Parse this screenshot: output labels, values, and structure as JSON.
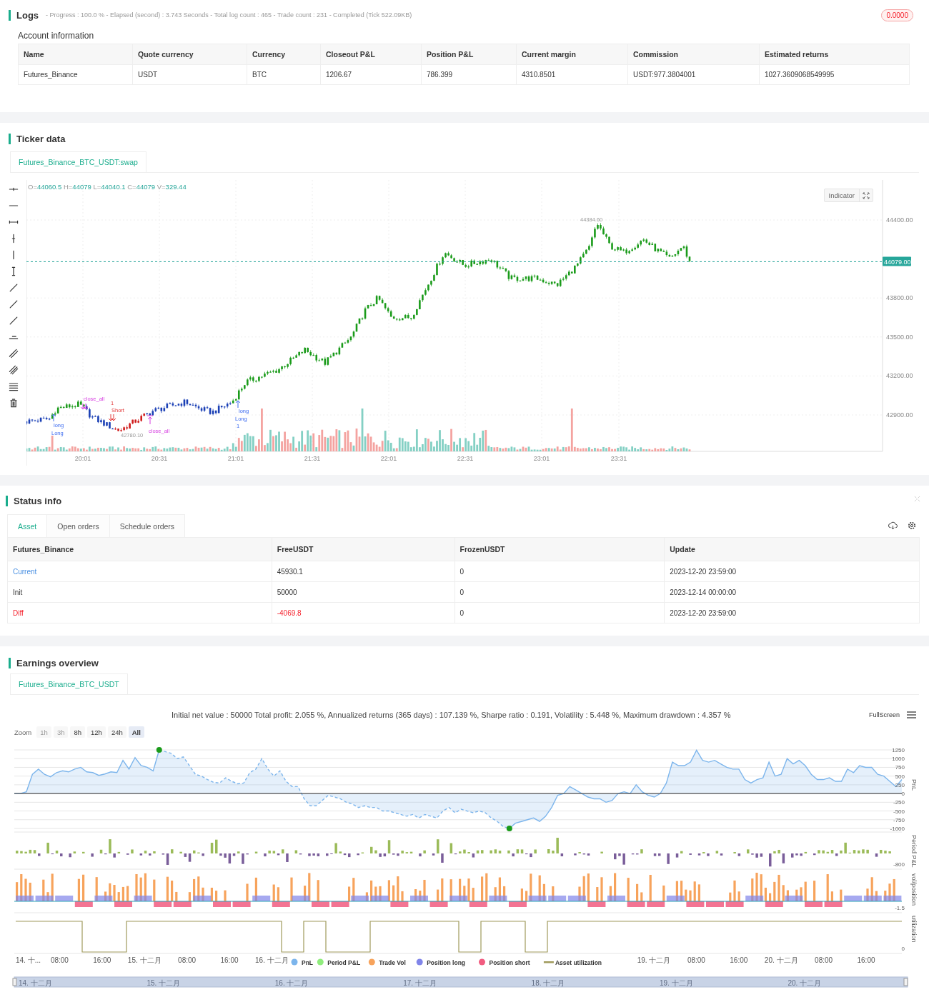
{
  "logs": {
    "title": "Logs",
    "summary": "- Progress : 100.0 % - Elapsed (second) : 3.743  Seconds - Total log count : 465 - Trade count : 231 - Completed (Tick 522.09KB)",
    "badge": "0.0000",
    "account_title": "Account information",
    "columns": [
      "Name",
      "Quote currency",
      "Currency",
      "Closeout P&L",
      "Position P&L",
      "Current margin",
      "Commission",
      "Estimated returns"
    ],
    "rows": [
      [
        "Futures_Binance",
        "USDT",
        "BTC",
        "1206.67",
        "786.399",
        "4310.8501",
        "USDT:977.3804001",
        "1027.3609068549995"
      ]
    ]
  },
  "ticker": {
    "title": "Ticker data",
    "tabs": [
      {
        "label": "Futures_Binance_BTC_USDT:swap",
        "selected": true
      }
    ],
    "ohlc": [
      {
        "label": "O=",
        "value": "44060.5"
      },
      {
        "label": " H=",
        "value": "44079"
      },
      {
        "label": " L=",
        "value": "44040.1"
      },
      {
        "label": " C=",
        "value": "44079"
      },
      {
        "label": " V=",
        "value": "329.44"
      }
    ],
    "indicator_button": "Indicator",
    "yticks": [
      "44400.00",
      "43800.00",
      "43500.00",
      "43200.00",
      "42900.00"
    ],
    "price_tag": "44079.00",
    "high_label": "44384.60",
    "low_label": "42780.10",
    "xticks": [
      "20:01",
      "20:31",
      "21:01",
      "21:31",
      "22:01",
      "22:31",
      "23:01",
      "23:31"
    ],
    "trade_labels": [
      {
        "kind": "long",
        "text": "long"
      },
      {
        "kind": "long",
        "text": "Long"
      },
      {
        "kind": "close",
        "text": "close_all"
      },
      {
        "kind": "short",
        "text": "1"
      },
      {
        "kind": "short",
        "text": "Short"
      },
      {
        "kind": "close",
        "text": "close_all"
      },
      {
        "kind": "long",
        "text": "long"
      },
      {
        "kind": "long",
        "text": "Long"
      },
      {
        "kind": "long",
        "text": "1"
      }
    ]
  },
  "status": {
    "title": "Status info",
    "tabs": [
      {
        "label": "Asset",
        "selected": true
      },
      {
        "label": "Open orders",
        "selected": false
      },
      {
        "label": "Schedule orders",
        "selected": false
      }
    ],
    "columns": [
      "Futures_Binance",
      "FreeUSDT",
      "FrozenUSDT",
      "Update"
    ],
    "rows": [
      {
        "cells": [
          {
            "text": "Current",
            "color": "#4a90e2"
          },
          {
            "text": "45930.1"
          },
          {
            "text": "0"
          },
          {
            "text": "2023-12-20 23:59:00"
          }
        ]
      },
      {
        "cells": [
          {
            "text": "Init"
          },
          {
            "text": "50000"
          },
          {
            "text": "0"
          },
          {
            "text": "2023-12-14 00:00:00"
          }
        ]
      },
      {
        "cells": [
          {
            "text": "Diff",
            "color": "#f5222d"
          },
          {
            "text": "-4069.8",
            "color": "#f5222d"
          },
          {
            "text": "0"
          },
          {
            "text": "2023-12-20 23:59:00"
          }
        ]
      }
    ]
  },
  "earnings": {
    "title": "Earnings overview",
    "tabs": [
      {
        "label": "Futures_Binance_BTC_USDT",
        "selected": true
      }
    ],
    "summary": "Initial net value : 50000 Total profit: 2.055 %, Annualized returns (365 days) : 107.139 %, Sharpe ratio : 0.191, Volatility : 5.448 %, Maximum drawdown : 4.357 %",
    "fullscreen": "FullScreen",
    "zoom_label": "Zoom",
    "zoom_buttons": [
      {
        "label": "1h",
        "selected": false,
        "disabled": true
      },
      {
        "label": "3h",
        "selected": false,
        "disabled": true
      },
      {
        "label": "8h",
        "selected": false,
        "disabled": false
      },
      {
        "label": "12h",
        "selected": false,
        "disabled": false
      },
      {
        "label": "24h",
        "selected": false,
        "disabled": false
      },
      {
        "label": "All",
        "selected": true,
        "disabled": false
      }
    ],
    "chart_data": {
      "type": "area",
      "ylabel": "PnL",
      "ylim": [
        -1000,
        1250
      ],
      "grid": true,
      "yticks": [
        1250,
        1000,
        750,
        500,
        250,
        0,
        -250,
        -500,
        -750,
        -1000
      ],
      "series": [
        {
          "color": "#7cb5ec",
          "values": [
            0,
            0,
            50,
            550,
            700,
            550,
            480,
            600,
            650,
            620,
            700,
            750,
            620,
            600,
            520,
            560,
            620,
            600,
            950,
            700,
            1030,
            800,
            750,
            650,
            1250,
            1200,
            1150,
            1000,
            1050,
            800,
            550,
            500,
            400,
            320,
            300,
            450,
            350,
            280,
            300,
            600,
            700,
            1000,
            700,
            500,
            650,
            350,
            200,
            200,
            -150,
            -350,
            -350,
            -200,
            -50,
            -100,
            -150,
            -250,
            -300,
            -400,
            -350,
            -400,
            -400,
            -500,
            -500,
            -550,
            -600,
            -650,
            -600,
            -700,
            -600,
            -650,
            -700,
            -500,
            -400,
            -550,
            -450,
            -500,
            -550,
            -500,
            -550,
            -700,
            -800,
            -950,
            -1000,
            -850,
            -800,
            -750,
            -700,
            -800,
            -650,
            -400,
            -50,
            0,
            200,
            100,
            0,
            -100,
            -150,
            -150,
            -250,
            -200,
            0,
            50,
            0,
            250,
            50,
            -50,
            -100,
            0,
            300,
            900,
            800,
            800,
            900,
            1240,
            950,
            900,
            950,
            850,
            750,
            700,
            700,
            400,
            300,
            400,
            450,
            900,
            500,
            550,
            1000,
            850,
            950,
            800,
            550,
            400,
            400,
            450,
            350,
            350,
            700,
            600,
            800,
            750,
            750,
            550,
            500,
            350,
            200,
            400
          ]
        }
      ]
    },
    "pane_labels": [
      {
        "title": "Period P&L",
        "tick": "-800"
      },
      {
        "title": "vol/position",
        "tick": "-1.5"
      },
      {
        "title": "utilization",
        "tick": "0"
      }
    ],
    "x_labels_left": [
      "14. 十...",
      "08:00",
      "16:00",
      "15. 十二月",
      "08:00",
      "16:00",
      "16. 十二月"
    ],
    "x_labels_right": [
      "19. 十二月",
      "08:00",
      "16:00",
      "20. 十二月",
      "08:00",
      "16:00"
    ],
    "legend": [
      {
        "label": "PnL",
        "color": "#7cb5ec",
        "kind": "dot"
      },
      {
        "label": "Period P&L",
        "color": "#90ed7d",
        "kind": "dot"
      },
      {
        "label": "Trade Vol",
        "color": "#f7a35c",
        "kind": "dot"
      },
      {
        "label": "Position long",
        "color": "#8085e9",
        "kind": "dot"
      },
      {
        "label": "Position short",
        "color": "#f15c80",
        "kind": "dot"
      },
      {
        "label": "Asset utilization",
        "color": "#a09a5c",
        "kind": "line"
      }
    ],
    "navigator_labels": [
      "14. 十二月",
      "15. 十二月",
      "16. 十二月",
      "17. 十二月",
      "18. 十二月",
      "19. 十二月",
      "20. 十二月"
    ]
  }
}
